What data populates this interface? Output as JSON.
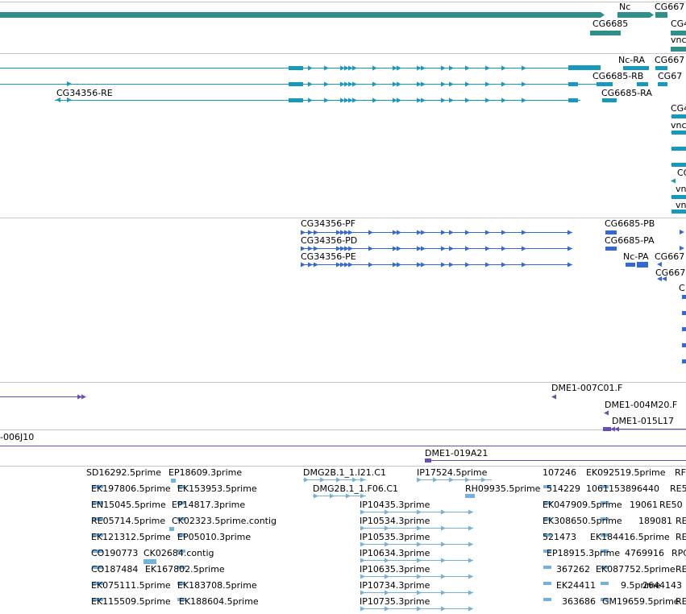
{
  "colors": {
    "gene": "#2f8f8a",
    "transcript": "#1798bd",
    "cds": "#3369d3",
    "clone": "#6a4eb0",
    "est": "#74b2dc",
    "divider": "#c8c8c8"
  },
  "tracks": {
    "gene_labels": [
      "Nc",
      "CG667",
      "CG6685",
      "CG4",
      "vnc"
    ],
    "transcript_labels": [
      "Nc-RA",
      "CG667",
      "CG6685-RB",
      "CG67",
      "CG34356-RE",
      "CG6685-RA",
      "CG4",
      "vnc",
      "CG",
      "vnc",
      "vnc"
    ],
    "cds_labels": [
      "CG34356-PF",
      "CG6685-PB",
      "CG34356-PD",
      "CG6685-PA",
      "CG34356-PE",
      "Nc-PA",
      "CG667",
      "CG667",
      "C"
    ],
    "clone_labels": [
      "DME1-007C01.F",
      "DME1-004M20.F",
      "DME1-015L17",
      "-006J10",
      "DME1-019A21"
    ],
    "est_labels": [
      "SD16292.5prime",
      "EP18609.3prime",
      "DMG2B.1_1.I21.C1",
      "IP17524.5prime",
      "107246",
      "EK09251",
      "9.5prime",
      "RF",
      "EK197806.5prime",
      "EK153953.5prime",
      "DMG2B.1_1.F06.C1",
      "RH09935.5prime",
      "514229",
      "1061153896440",
      "RE5",
      "EN15045.5prime",
      "EP14817.3prime",
      "IP10435.3prime",
      "EK047909.5prime",
      "19061",
      "RE50",
      "RE05714.5prime",
      "CK02323.5prime.contig",
      "IP10534.3prime",
      "EK308650.5prime",
      "189081",
      "RE",
      "EK121312.5prime",
      "EP05010.3prime",
      "IP10535.3prime",
      "521473",
      "EK184416.5prime",
      "RE",
      "CO190773",
      "CK02684.contig",
      "IP10634.3prime",
      "EP18915.3prime",
      "4769916",
      "RPC",
      "CO187484",
      "EK167802.5prime",
      "IP10635.3prime",
      "367262",
      "EK087752.5prime",
      "RE",
      "EK075111.5prime",
      "EK183708.5prime",
      "IP10734.3prime",
      "EK24411",
      "9.5prime",
      "2644143",
      "EK115509.5prime",
      "EK188604.5prime",
      "IP10735.3prime",
      "363686",
      "GM19659.5prime",
      "RE"
    ]
  }
}
